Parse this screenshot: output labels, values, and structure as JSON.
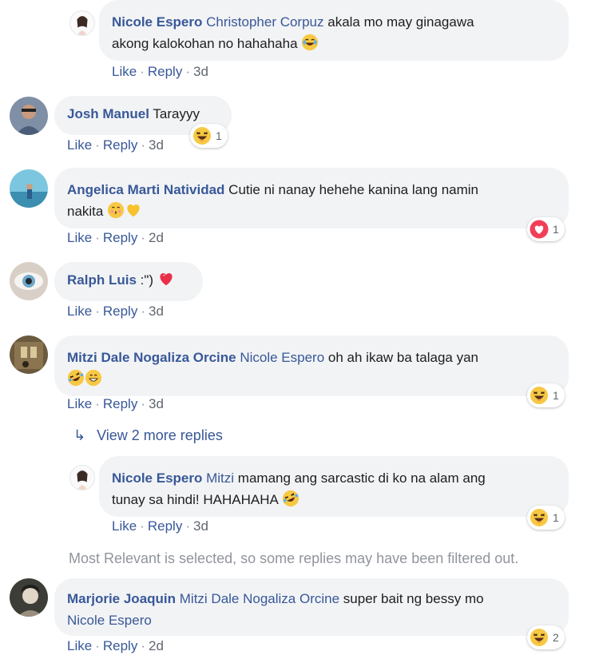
{
  "comments": [
    {
      "author": "Nicole Espero",
      "mention": "Christopher Corpuz",
      "text_line1": "akala mo may ginagawa",
      "text_line2": "akong kalokohan no hahahaha",
      "actions": {
        "like": "Like",
        "reply": "Reply",
        "time": "3d"
      },
      "emoji": "laughing-tears-emoji"
    },
    {
      "author": "Josh Manuel",
      "text": "Tarayyy",
      "actions": {
        "like": "Like",
        "reply": "Reply",
        "time": "3d"
      },
      "reaction": {
        "icon": "haha-reaction-icon",
        "count": "1"
      }
    },
    {
      "author": "Angelica Marti Natividad",
      "text_line1": "Cutie ni nanay hehehe kanina lang namin",
      "text_line2": "nakita",
      "actions": {
        "like": "Like",
        "reply": "Reply",
        "time": "2d"
      },
      "reaction": {
        "icon": "love-reaction-icon",
        "count": "1"
      },
      "emojis": [
        "kissing-face-emoji",
        "yellow-heart-emoji"
      ]
    },
    {
      "author": "Ralph Luis",
      "text": ":\")",
      "actions": {
        "like": "Like",
        "reply": "Reply",
        "time": "3d"
      },
      "emoji": "sparkling-heart-emoji"
    },
    {
      "author": "Mitzi Dale Nogaliza Orcine",
      "mention": "Nicole Espero",
      "text_line1": "oh ah ikaw ba talaga yan",
      "actions": {
        "like": "Like",
        "reply": "Reply",
        "time": "3d"
      },
      "reaction": {
        "icon": "haha-reaction-icon",
        "count": "1"
      },
      "emojis": [
        "rofl-emoji",
        "grinning-emoji"
      ]
    },
    {
      "author": "Nicole Espero",
      "mention": "Mitzi",
      "text_line1": "mamang ang sarcastic di ko na alam ang",
      "text_line2": "tunay sa hindi! HAHAHAHA",
      "actions": {
        "like": "Like",
        "reply": "Reply",
        "time": "3d"
      },
      "reaction": {
        "icon": "haha-reaction-icon",
        "count": "1"
      },
      "emoji": "rofl-emoji"
    },
    {
      "author": "Marjorie Joaquin",
      "mention": "Mitzi Dale Nogaliza Orcine",
      "text_line1": "super bait ng bessy mo",
      "mention2": "Nicole Espero",
      "actions": {
        "like": "Like",
        "reply": "Reply",
        "time": "2d"
      },
      "reaction": {
        "icon": "haha-reaction-icon",
        "count": "2"
      }
    }
  ],
  "view_more_replies": "View 2 more replies",
  "filter_note": "Most Relevant is selected, so some replies may have been filtered out.",
  "colors": {
    "link": "#385898",
    "bubble": "#f2f3f5",
    "muted": "#90949c"
  }
}
